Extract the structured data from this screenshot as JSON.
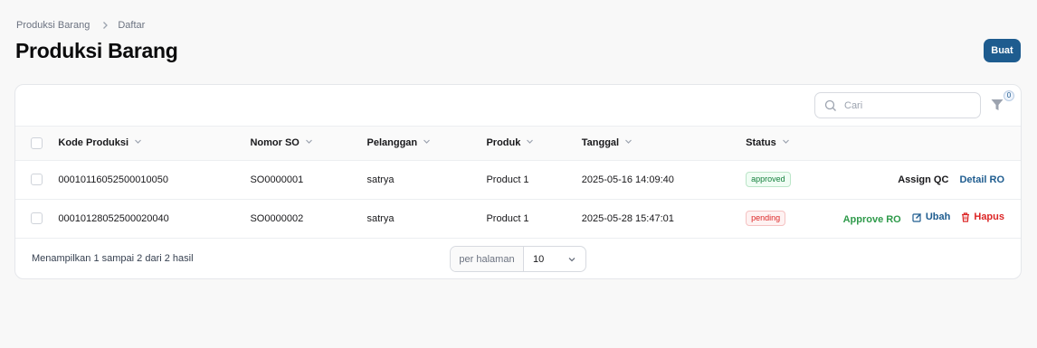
{
  "breadcrumb": {
    "root": "Produksi Barang",
    "current": "Daftar"
  },
  "page": {
    "title": "Produksi Barang",
    "create_label": "Buat"
  },
  "search": {
    "placeholder": "Cari"
  },
  "filter": {
    "count": "0"
  },
  "table": {
    "columns": [
      "Kode Produksi",
      "Nomor SO",
      "Pelanggan",
      "Produk",
      "Tanggal",
      "Status"
    ],
    "rows": [
      {
        "kode": "00010116052500010050",
        "nomor_so": "SO0000001",
        "pelanggan": "satrya",
        "produk": "Product 1",
        "tanggal": "2025-05-16 14:09:40",
        "status": "approved",
        "actions": [
          "Assign QC",
          "Detail RO"
        ]
      },
      {
        "kode": "00010128052500020040",
        "nomor_so": "SO0000002",
        "pelanggan": "satrya",
        "produk": "Product 1",
        "tanggal": "2025-05-28 15:47:01",
        "status": "pending",
        "actions": [
          "Approve RO",
          "Ubah",
          "Hapus"
        ]
      }
    ]
  },
  "footer": {
    "summary": "Menampilkan 1 sampai 2 dari 2 hasil",
    "per_page_label": "per halaman",
    "per_page_value": "10"
  },
  "colors": {
    "primary": "#1e5c8f",
    "approved": "#15803d",
    "pending": "#dc2626"
  }
}
